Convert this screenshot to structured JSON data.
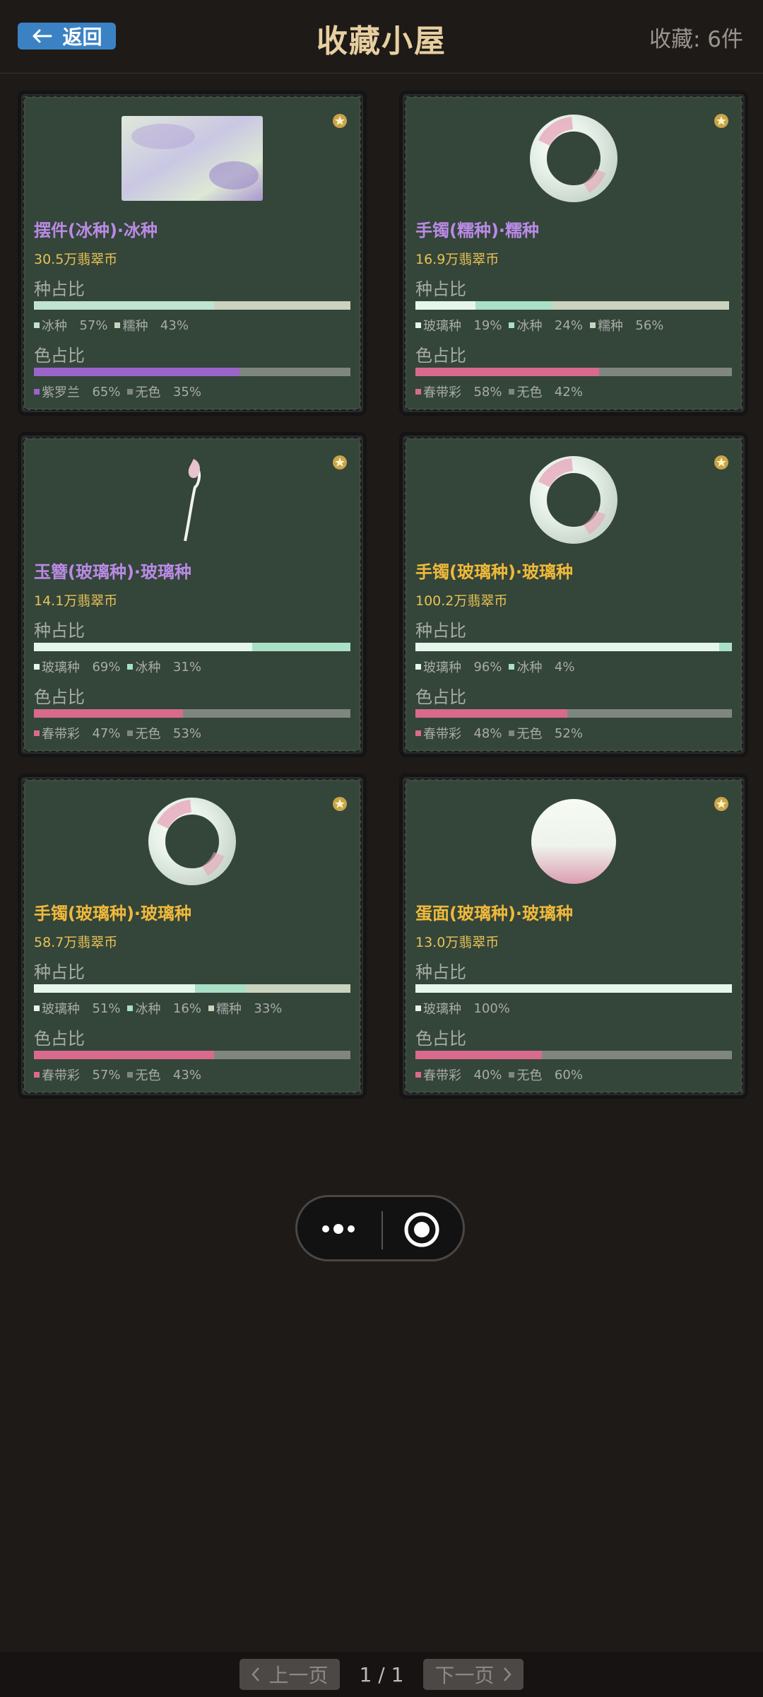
{
  "header": {
    "back_label": "返回",
    "title": "收藏小屋",
    "count": "收藏: 6件"
  },
  "labels": {
    "species": "种占比",
    "color": "色占比"
  },
  "cards": [
    {
      "name": "摆件(冰种)·冰种",
      "name_color": "#b98ae6",
      "price": "30.5万翡翠币",
      "species": [
        {
          "label": "冰种",
          "pct": 57,
          "text": "57%",
          "color": "#bfe4d0"
        },
        {
          "label": "糯种",
          "pct": 43,
          "text": "43%",
          "color": "#c9d3bd"
        }
      ],
      "colors": [
        {
          "label": "紫罗兰",
          "pct": 65,
          "text": "65%",
          "color": "#9b64c8"
        },
        {
          "label": "无色",
          "pct": 35,
          "text": "35%",
          "color": "#7f8680"
        }
      ],
      "image": "rect-jade"
    },
    {
      "name": "手镯(糯种)·糯种",
      "name_color": "#b98ae6",
      "price": "16.9万翡翠币",
      "species": [
        {
          "label": "玻璃种",
          "pct": 19,
          "text": "19%",
          "color": "#e6f6ec"
        },
        {
          "label": "冰种",
          "pct": 24,
          "text": "24%",
          "color": "#a9e0c6"
        },
        {
          "label": "糯种",
          "pct": 56,
          "text": "56%",
          "color": "#c9d3bd"
        }
      ],
      "colors": [
        {
          "label": "春带彩",
          "pct": 58,
          "text": "58%",
          "color": "#d86a8e"
        },
        {
          "label": "无色",
          "pct": 42,
          "text": "42%",
          "color": "#7f8680"
        }
      ],
      "image": "bangle"
    },
    {
      "name": "玉簪(玻璃种)·玻璃种",
      "name_color": "#b98ae6",
      "price": "14.1万翡翠币",
      "species": [
        {
          "label": "玻璃种",
          "pct": 69,
          "text": "69%",
          "color": "#e6f6ec"
        },
        {
          "label": "冰种",
          "pct": 31,
          "text": "31%",
          "color": "#a9e0c6"
        }
      ],
      "colors": [
        {
          "label": "春带彩",
          "pct": 47,
          "text": "47%",
          "color": "#d86a8e"
        },
        {
          "label": "无色",
          "pct": 53,
          "text": "53%",
          "color": "#7f8680"
        }
      ],
      "image": "hairpin"
    },
    {
      "name": "手镯(玻璃种)·玻璃种",
      "name_color": "#f0b93a",
      "price": "100.2万翡翠币",
      "species": [
        {
          "label": "玻璃种",
          "pct": 96,
          "text": "96%",
          "color": "#e6f6ec"
        },
        {
          "label": "冰种",
          "pct": 4,
          "text": "4%",
          "color": "#a9e0c6"
        }
      ],
      "colors": [
        {
          "label": "春带彩",
          "pct": 48,
          "text": "48%",
          "color": "#d86a8e"
        },
        {
          "label": "无色",
          "pct": 52,
          "text": "52%",
          "color": "#7f8680"
        }
      ],
      "image": "bangle"
    },
    {
      "name": "手镯(玻璃种)·玻璃种",
      "name_color": "#f0b93a",
      "price": "58.7万翡翠币",
      "species": [
        {
          "label": "玻璃种",
          "pct": 51,
          "text": "51%",
          "color": "#e6f6ec"
        },
        {
          "label": "冰种",
          "pct": 16,
          "text": "16%",
          "color": "#a9e0c6"
        },
        {
          "label": "糯种",
          "pct": 33,
          "text": "33%",
          "color": "#c9d3bd"
        }
      ],
      "colors": [
        {
          "label": "春带彩",
          "pct": 57,
          "text": "57%",
          "color": "#d86a8e"
        },
        {
          "label": "无色",
          "pct": 43,
          "text": "43%",
          "color": "#7f8680"
        }
      ],
      "image": "bangle"
    },
    {
      "name": "蛋面(玻璃种)·玻璃种",
      "name_color": "#f0b93a",
      "price": "13.0万翡翠币",
      "species": [
        {
          "label": "玻璃种",
          "pct": 100,
          "text": "100%",
          "color": "#e6f6ec"
        }
      ],
      "colors": [
        {
          "label": "春带彩",
          "pct": 40,
          "text": "40%",
          "color": "#d86a8e"
        },
        {
          "label": "无色",
          "pct": 60,
          "text": "60%",
          "color": "#7f8680"
        }
      ],
      "image": "cabochon"
    }
  ],
  "pagination": {
    "prev": "上一页",
    "page": "1 / 1",
    "next": "下一页"
  }
}
